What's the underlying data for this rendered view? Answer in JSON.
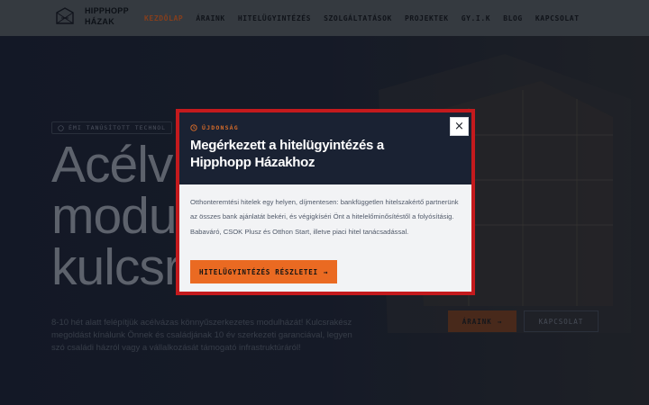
{
  "header": {
    "logo_line1": "HIPPHOPP",
    "logo_line2": "HÁZAK",
    "nav": [
      {
        "label": "KEZDŐLAP",
        "active": true
      },
      {
        "label": "ÁRAINK",
        "active": false
      },
      {
        "label": "HITELÜGYINTÉZÉS",
        "active": false
      },
      {
        "label": "SZOLGÁLTATÁSOK",
        "active": false
      },
      {
        "label": "PROJEKTEK",
        "active": false
      },
      {
        "label": "GY.I.K",
        "active": false
      },
      {
        "label": "BLOG",
        "active": false
      },
      {
        "label": "KAPCSOLAT",
        "active": false
      }
    ]
  },
  "hero": {
    "badge": "ÉMI TANÚSÍTOTT TECHNOL",
    "title_line1": "Acélv",
    "title_line2": "modu",
    "title_line3": "kulcsr",
    "description": "8-10 hét alatt felépítjük acélvázas könnyűszerkezetes modulházát! Kulcsrakész megoldást kínálunk Önnek és családjának 10 év szerkezeti garanciával, legyen szó családi házról vagy a vállalkozását támogató infrastruktúráról!",
    "primary_button": "ÁRAINK",
    "primary_arrow": "→",
    "secondary_button": "KAPCSOLAT"
  },
  "modal": {
    "tag": "ÚJDONSÁG",
    "title": "Megérkezett a hitelügyintézés a Hipphopp Házakhoz",
    "close": "×",
    "body": "Otthonteremtési hitelek egy helyen, díjmentesen: bankfüggetlen hitelszakértő partnerünk az összes bank ajánlatát bekéri, és végigkíséri Önt a hitelelőminősítéstől a folyósításig. Babaváró, CSOK Plusz és Otthon Start, illetve piaci hitel tanácsadással.",
    "cta": "HITELÜGYINTÉZÉS RÉSZLETEI",
    "cta_arrow": "→",
    "accent_color": "#ea6a22",
    "border_color": "#c41a1d"
  }
}
